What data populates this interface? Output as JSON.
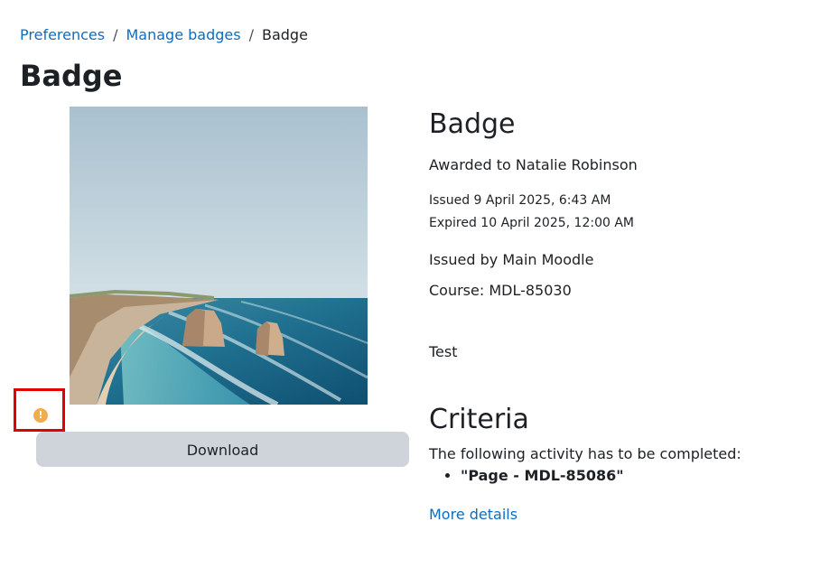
{
  "breadcrumb": {
    "items": [
      "Preferences",
      "Manage badges"
    ],
    "separator": "/",
    "current": "Badge"
  },
  "page_title": "Badge",
  "badge_image": {
    "icon": "coastline-photo"
  },
  "warning": {
    "glyph": "!",
    "icon": "warning-circle-icon",
    "color": "#f0ad4e"
  },
  "download_label": "Download",
  "details": {
    "title": "Badge",
    "awarded_to": "Awarded to Natalie Robinson",
    "issued": "Issued 9 April 2025, 6:43 AM",
    "expired": "Expired 10 April 2025, 12:00 AM",
    "issued_by": "Issued by Main Moodle",
    "course": "Course: MDL-85030",
    "description": "Test"
  },
  "criteria": {
    "title": "Criteria",
    "intro": "The following activity has to be completed:",
    "items": [
      "\"Page - MDL-85086\""
    ],
    "more_details": "More details"
  },
  "colors": {
    "link": "#0f6cbf",
    "text": "#1d2125",
    "button_bg": "#ced4da",
    "highlight_border": "#e00000"
  }
}
